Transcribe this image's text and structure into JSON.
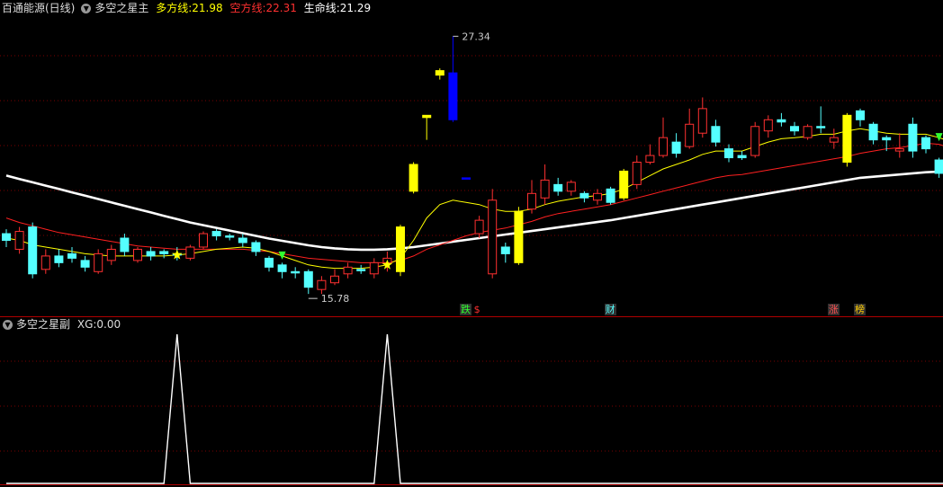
{
  "main_header": {
    "stock": "百通能源(日线)",
    "indicator": "多空之星主",
    "bull_label": "多方线:",
    "bull_value": "21.98",
    "bear_label": "空方线:",
    "bear_value": "22.31",
    "life_label": "生命线:",
    "life_value": "21.29"
  },
  "sub_header": {
    "indicator": "多空之星副",
    "xg_label": "XG:",
    "xg_value": "0.00"
  },
  "colors": {
    "up": "#ff3030",
    "down": "#54ffff",
    "signal": "#ffff00",
    "limit": "#0000ff",
    "bull_line": "#ffff00",
    "bear_line": "#ff2020",
    "life_line": "#ffffff",
    "grid": "#7a0000"
  },
  "chart_data": [
    {
      "type": "candlestick",
      "price_range": [
        14.8,
        28.4
      ],
      "high_label": "27.34",
      "low_label": "15.78",
      "candles": [
        {
          "o": 18.5,
          "c": 18.2,
          "h": 18.7,
          "l": 17.9,
          "color": "down"
        },
        {
          "o": 17.8,
          "c": 18.6,
          "h": 18.8,
          "l": 17.6,
          "color": "up"
        },
        {
          "o": 18.8,
          "c": 16.7,
          "h": 19.0,
          "l": 16.5,
          "color": "down"
        },
        {
          "o": 16.9,
          "c": 17.5,
          "h": 17.8,
          "l": 16.7,
          "color": "up"
        },
        {
          "o": 17.5,
          "c": 17.2,
          "h": 17.8,
          "l": 17.0,
          "color": "down"
        },
        {
          "o": 17.6,
          "c": 17.4,
          "h": 17.9,
          "l": 17.2,
          "color": "down"
        },
        {
          "o": 17.3,
          "c": 17.0,
          "h": 17.5,
          "l": 16.8,
          "color": "down"
        },
        {
          "o": 16.8,
          "c": 17.6,
          "h": 17.8,
          "l": 16.7,
          "color": "up"
        },
        {
          "o": 17.3,
          "c": 17.8,
          "h": 18.0,
          "l": 17.1,
          "color": "up"
        },
        {
          "o": 18.3,
          "c": 17.7,
          "h": 18.5,
          "l": 17.5,
          "color": "down"
        },
        {
          "o": 17.3,
          "c": 17.8,
          "h": 17.9,
          "l": 17.2,
          "color": "up"
        },
        {
          "o": 17.7,
          "c": 17.5,
          "h": 17.9,
          "l": 17.3,
          "color": "down"
        },
        {
          "o": 17.7,
          "c": 17.6,
          "h": 17.8,
          "l": 17.4,
          "color": "down"
        },
        {
          "o": 17.6,
          "c": 17.6,
          "h": 17.9,
          "l": 17.3,
          "color": "down"
        },
        {
          "o": 17.4,
          "c": 17.9,
          "h": 18.0,
          "l": 17.3,
          "color": "up"
        },
        {
          "o": 17.9,
          "c": 18.5,
          "h": 18.6,
          "l": 17.8,
          "color": "up"
        },
        {
          "o": 18.6,
          "c": 18.4,
          "h": 18.7,
          "l": 18.2,
          "color": "down"
        },
        {
          "o": 18.4,
          "c": 18.4,
          "h": 18.5,
          "l": 18.2,
          "color": "down"
        },
        {
          "o": 18.3,
          "c": 18.1,
          "h": 18.5,
          "l": 17.9,
          "color": "down"
        },
        {
          "o": 18.1,
          "c": 17.7,
          "h": 18.2,
          "l": 17.5,
          "color": "down"
        },
        {
          "o": 17.4,
          "c": 17.0,
          "h": 17.5,
          "l": 16.8,
          "color": "down"
        },
        {
          "o": 17.1,
          "c": 16.8,
          "h": 17.2,
          "l": 16.5,
          "color": "down"
        },
        {
          "o": 16.8,
          "c": 16.8,
          "h": 17.0,
          "l": 16.5,
          "color": "down"
        },
        {
          "o": 16.8,
          "c": 16.1,
          "h": 16.9,
          "l": 15.8,
          "color": "down"
        },
        {
          "o": 16.0,
          "c": 16.4,
          "h": 16.6,
          "l": 15.8,
          "color": "up"
        },
        {
          "o": 16.3,
          "c": 16.6,
          "h": 16.9,
          "l": 16.2,
          "color": "up"
        },
        {
          "o": 16.7,
          "c": 17.0,
          "h": 17.2,
          "l": 16.5,
          "color": "up"
        },
        {
          "o": 16.9,
          "c": 16.9,
          "h": 17.1,
          "l": 16.7,
          "color": "down"
        },
        {
          "o": 16.7,
          "c": 17.2,
          "h": 17.4,
          "l": 16.5,
          "color": "up"
        },
        {
          "o": 17.2,
          "c": 17.4,
          "h": 17.7,
          "l": 16.8,
          "color": "up"
        },
        {
          "o": 16.8,
          "c": 18.8,
          "h": 18.9,
          "l": 16.6,
          "color": "signal"
        },
        {
          "o": 20.4,
          "c": 21.6,
          "h": 21.7,
          "l": 20.3,
          "color": "signal"
        },
        {
          "o": 23.7,
          "c": 23.8,
          "h": 23.8,
          "l": 22.7,
          "color": "signal"
        },
        {
          "o": 25.6,
          "c": 25.8,
          "h": 25.9,
          "l": 25.4,
          "color": "signal"
        },
        {
          "o": 25.7,
          "c": 23.6,
          "h": 27.34,
          "l": 23.5,
          "color": "limit"
        },
        {
          "o": 21.0,
          "c": 21.0,
          "h": 21.0,
          "l": 21.0,
          "color": "limit"
        },
        {
          "o": 18.5,
          "c": 19.1,
          "h": 19.3,
          "l": 18.3,
          "color": "up"
        },
        {
          "o": 20.0,
          "c": 16.7,
          "h": 20.5,
          "l": 16.5,
          "color": "up"
        },
        {
          "o": 17.9,
          "c": 17.6,
          "h": 18.1,
          "l": 17.2,
          "color": "down"
        },
        {
          "o": 17.2,
          "c": 19.5,
          "h": 19.7,
          "l": 17.1,
          "color": "signal"
        },
        {
          "o": 19.6,
          "c": 20.3,
          "h": 20.9,
          "l": 19.4,
          "color": "up"
        },
        {
          "o": 20.1,
          "c": 20.9,
          "h": 21.6,
          "l": 19.8,
          "color": "up"
        },
        {
          "o": 20.7,
          "c": 20.4,
          "h": 21.0,
          "l": 20.2,
          "color": "down"
        },
        {
          "o": 20.4,
          "c": 20.8,
          "h": 20.9,
          "l": 20.2,
          "color": "up"
        },
        {
          "o": 20.3,
          "c": 20.1,
          "h": 20.4,
          "l": 19.9,
          "color": "down"
        },
        {
          "o": 20.3,
          "c": 20.0,
          "h": 20.5,
          "l": 19.8,
          "color": "up"
        },
        {
          "o": 19.9,
          "c": 20.5,
          "h": 20.6,
          "l": 19.8,
          "color": "down"
        },
        {
          "o": 20.1,
          "c": 21.3,
          "h": 21.4,
          "l": 20.0,
          "color": "signal"
        },
        {
          "o": 20.7,
          "c": 21.7,
          "h": 22.0,
          "l": 20.5,
          "color": "up"
        },
        {
          "o": 21.7,
          "c": 22.0,
          "h": 22.5,
          "l": 21.6,
          "color": "up"
        },
        {
          "o": 22.0,
          "c": 22.8,
          "h": 23.7,
          "l": 21.9,
          "color": "up"
        },
        {
          "o": 22.6,
          "c": 22.1,
          "h": 23.0,
          "l": 21.9,
          "color": "down"
        },
        {
          "o": 22.4,
          "c": 23.4,
          "h": 24.1,
          "l": 22.3,
          "color": "up"
        },
        {
          "o": 23.0,
          "c": 24.1,
          "h": 24.6,
          "l": 22.8,
          "color": "up"
        },
        {
          "o": 23.3,
          "c": 22.6,
          "h": 23.6,
          "l": 22.4,
          "color": "down"
        },
        {
          "o": 22.3,
          "c": 21.9,
          "h": 22.5,
          "l": 21.7,
          "color": "down"
        },
        {
          "o": 21.9,
          "c": 22.0,
          "h": 22.2,
          "l": 21.8,
          "color": "down"
        },
        {
          "o": 22.0,
          "c": 23.3,
          "h": 23.5,
          "l": 21.9,
          "color": "up"
        },
        {
          "o": 23.1,
          "c": 23.6,
          "h": 23.8,
          "l": 22.8,
          "color": "up"
        },
        {
          "o": 23.6,
          "c": 23.5,
          "h": 23.9,
          "l": 23.3,
          "color": "down"
        },
        {
          "o": 23.3,
          "c": 23.1,
          "h": 23.5,
          "l": 22.9,
          "color": "down"
        },
        {
          "o": 22.8,
          "c": 23.3,
          "h": 23.4,
          "l": 22.7,
          "color": "up"
        },
        {
          "o": 23.3,
          "c": 23.3,
          "h": 24.2,
          "l": 23.0,
          "color": "down"
        },
        {
          "o": 22.6,
          "c": 22.8,
          "h": 23.2,
          "l": 22.3,
          "color": "up"
        },
        {
          "o": 21.7,
          "c": 23.8,
          "h": 23.9,
          "l": 21.5,
          "color": "signal"
        },
        {
          "o": 24.0,
          "c": 23.6,
          "h": 24.1,
          "l": 23.3,
          "color": "down"
        },
        {
          "o": 23.4,
          "c": 22.7,
          "h": 23.5,
          "l": 22.5,
          "color": "down"
        },
        {
          "o": 22.8,
          "c": 22.7,
          "h": 22.9,
          "l": 22.2,
          "color": "down"
        },
        {
          "o": 22.2,
          "c": 22.3,
          "h": 23.0,
          "l": 21.9,
          "color": "up"
        },
        {
          "o": 23.4,
          "c": 22.2,
          "h": 23.7,
          "l": 21.9,
          "color": "down"
        },
        {
          "o": 22.8,
          "c": 22.3,
          "h": 22.9,
          "l": 22.1,
          "color": "down"
        },
        {
          "o": 21.8,
          "c": 21.2,
          "h": 21.9,
          "l": 21.0,
          "color": "down"
        },
        {
          "o": 21.1,
          "c": 20.5,
          "h": 21.2,
          "l": 20.2,
          "color": "down"
        }
      ],
      "bull_line": [
        18.3,
        18.2,
        18.0,
        17.9,
        17.8,
        17.7,
        17.6,
        17.55,
        17.5,
        17.5,
        17.5,
        17.5,
        17.5,
        17.55,
        17.6,
        17.7,
        17.8,
        17.85,
        17.9,
        17.85,
        17.7,
        17.5,
        17.3,
        17.1,
        17.0,
        16.95,
        16.95,
        16.95,
        17.0,
        17.1,
        17.4,
        18.2,
        19.2,
        19.8,
        20.0,
        19.9,
        19.8,
        19.6,
        19.5,
        19.5,
        19.6,
        19.8,
        19.95,
        20.05,
        20.15,
        20.2,
        20.3,
        20.5,
        20.8,
        21.1,
        21.4,
        21.6,
        21.8,
        22.05,
        22.2,
        22.2,
        22.2,
        22.4,
        22.6,
        22.75,
        22.8,
        22.85,
        22.95,
        22.95,
        23.1,
        23.2,
        23.1,
        23.0,
        22.95,
        22.95,
        22.95,
        22.8,
        22.6
      ],
      "bear_line": [
        19.2,
        19.0,
        18.85,
        18.7,
        18.55,
        18.45,
        18.35,
        18.25,
        18.15,
        18.05,
        17.95,
        17.9,
        17.85,
        17.8,
        17.8,
        17.8,
        17.8,
        17.8,
        17.8,
        17.75,
        17.7,
        17.6,
        17.5,
        17.4,
        17.35,
        17.3,
        17.25,
        17.2,
        17.2,
        17.2,
        17.3,
        17.5,
        17.8,
        18.0,
        18.2,
        18.4,
        18.55,
        18.65,
        18.75,
        18.9,
        19.05,
        19.25,
        19.4,
        19.5,
        19.6,
        19.7,
        19.8,
        19.95,
        20.1,
        20.25,
        20.4,
        20.55,
        20.7,
        20.85,
        21.0,
        21.1,
        21.15,
        21.25,
        21.35,
        21.45,
        21.55,
        21.65,
        21.75,
        21.85,
        21.95,
        22.1,
        22.2,
        22.3,
        22.35,
        22.45,
        22.55,
        22.5,
        22.31
      ],
      "life_line": [
        21.1,
        20.95,
        20.8,
        20.65,
        20.5,
        20.35,
        20.2,
        20.05,
        19.9,
        19.75,
        19.6,
        19.45,
        19.3,
        19.15,
        19.0,
        18.88,
        18.76,
        18.64,
        18.52,
        18.4,
        18.28,
        18.18,
        18.08,
        17.98,
        17.9,
        17.84,
        17.8,
        17.78,
        17.78,
        17.8,
        17.84,
        17.9,
        17.98,
        18.06,
        18.14,
        18.22,
        18.3,
        18.38,
        18.46,
        18.54,
        18.62,
        18.7,
        18.78,
        18.86,
        18.94,
        19.02,
        19.1,
        19.2,
        19.3,
        19.4,
        19.5,
        19.6,
        19.7,
        19.8,
        19.9,
        20.0,
        20.1,
        20.2,
        20.3,
        20.4,
        20.5,
        20.6,
        20.7,
        20.8,
        20.9,
        21.0,
        21.05,
        21.1,
        21.15,
        21.2,
        21.25,
        21.28,
        21.29
      ],
      "star_markers": [
        {
          "i": 13,
          "color": "#ffff00"
        },
        {
          "i": 29,
          "color": "#ffff00"
        }
      ],
      "arrow_markers": [
        {
          "i": 21,
          "color": "#30ff30"
        },
        {
          "i": 71,
          "color": "#30ff30"
        }
      ],
      "text_markers": [
        {
          "i": 35,
          "text": "跌",
          "color": "#30ff30",
          "bg": "#303030"
        },
        {
          "i": 36,
          "text": "$",
          "color": "#ff3030",
          "bg": "#000000"
        },
        {
          "i": 46,
          "text": "财",
          "color": "#54ffff",
          "bg": "#303030"
        },
        {
          "i": 63,
          "text": "涨",
          "color": "#ff5050",
          "bg": "#303030"
        },
        {
          "i": 65,
          "text": "榜",
          "color": "#ffcc00",
          "bg": "#303030"
        }
      ]
    },
    {
      "type": "line",
      "series_name": "XG",
      "values": [
        0,
        0,
        0,
        0,
        0,
        0,
        0,
        0,
        0,
        0,
        0,
        0,
        0,
        1,
        0,
        0,
        0,
        0,
        0,
        0,
        0,
        0,
        0,
        0,
        0,
        0,
        0,
        0,
        0,
        1,
        0,
        0,
        0,
        0,
        0,
        0,
        0,
        0,
        0,
        0,
        0,
        0,
        0,
        0,
        0,
        0,
        0,
        0,
        0,
        0,
        0,
        0,
        0,
        0,
        0,
        0,
        0,
        0,
        0,
        0,
        0,
        0,
        0,
        0,
        0,
        0,
        0,
        0,
        0,
        0,
        0,
        0,
        0
      ],
      "ylim": [
        0,
        1
      ]
    }
  ]
}
